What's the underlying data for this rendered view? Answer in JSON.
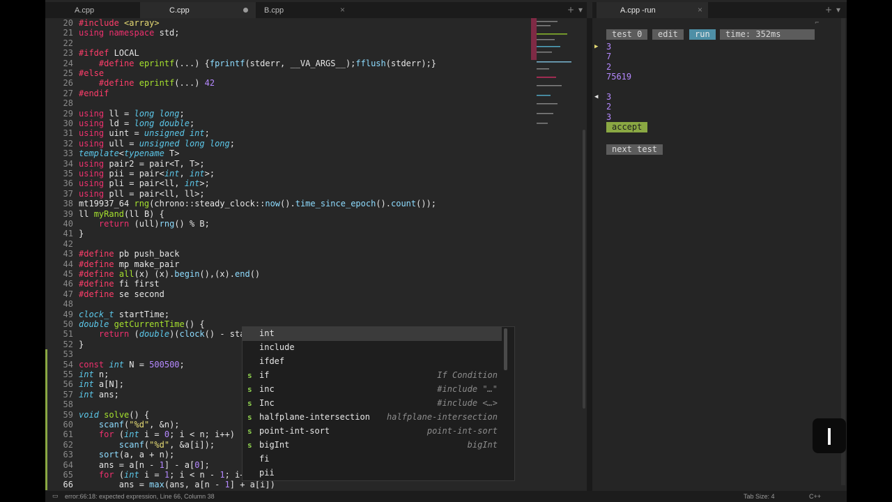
{
  "left_tabs": [
    {
      "label": "A.cpp",
      "close": "×",
      "active": false
    },
    {
      "label": "C.cpp",
      "close": "",
      "active": true,
      "modified": true
    },
    {
      "label": "B.cpp",
      "close": "×",
      "active": false
    }
  ],
  "tab_controls": {
    "add": "+",
    "menu": "▾",
    "back": "◀",
    "forward": "▶"
  },
  "right_tab": {
    "label": "A.cpp -run",
    "close": "×"
  },
  "editor": {
    "current_line": 66,
    "lines": [
      {
        "num": 20,
        "html": "<span class='p'>#include</span> <span class='s'>&lt;array&gt;</span>"
      },
      {
        "num": 21,
        "html": "<span class='k'>using namespace</span> std;"
      },
      {
        "num": 22,
        "html": ""
      },
      {
        "num": 23,
        "html": "<span class='p'>#ifdef</span> LOCAL"
      },
      {
        "num": 24,
        "html": "    <span class='p'>#define</span> <span class='f'>eprintf</span>(...) {<span class='m'>fprintf</span>(stderr, __VA_ARGS__);<span class='m'>fflush</span>(stderr);}"
      },
      {
        "num": 25,
        "html": "<span class='p'>#else</span>"
      },
      {
        "num": 26,
        "html": "    <span class='p'>#define</span> <span class='f'>eprintf</span>(...) <span class='n'>42</span>"
      },
      {
        "num": 27,
        "html": "<span class='p'>#endif</span>"
      },
      {
        "num": 28,
        "html": ""
      },
      {
        "num": 29,
        "html": "<span class='k'>using</span> ll = <span class='t'>long long</span>;"
      },
      {
        "num": 30,
        "html": "<span class='k'>using</span> ld = <span class='t'>long double</span>;"
      },
      {
        "num": 31,
        "html": "<span class='k'>using</span> uint = <span class='t'>unsigned int</span>;"
      },
      {
        "num": 32,
        "html": "<span class='k'>using</span> ull = <span class='t'>unsigned long long</span>;"
      },
      {
        "num": 33,
        "html": "<span class='t'>template</span>&lt;<span class='t'>typename</span> T&gt;"
      },
      {
        "num": 34,
        "html": "<span class='k'>using</span> pair2 = pair&lt;T, T&gt;;"
      },
      {
        "num": 35,
        "html": "<span class='k'>using</span> pii = pair&lt;<span class='t'>int</span>, <span class='t'>int</span>&gt;;"
      },
      {
        "num": 36,
        "html": "<span class='k'>using</span> pli = pair&lt;ll, <span class='t'>int</span>&gt;;"
      },
      {
        "num": 37,
        "html": "<span class='k'>using</span> pll = pair&lt;ll, ll&gt;;"
      },
      {
        "num": 38,
        "html": "mt19937_64 <span class='f'>rng</span>(chrono::steady_clock::<span class='m'>now</span>().<span class='m'>time_since_epoch</span>().<span class='m'>count</span>());"
      },
      {
        "num": 39,
        "html": "ll <span class='f'>myRand</span>(ll B) {"
      },
      {
        "num": 40,
        "html": "    <span class='k'>return</span> (ull)<span class='m'>rng</span>() % B;"
      },
      {
        "num": 41,
        "html": "}"
      },
      {
        "num": 42,
        "html": ""
      },
      {
        "num": 43,
        "html": "<span class='p'>#define</span> pb push_back"
      },
      {
        "num": 44,
        "html": "<span class='p'>#define</span> mp make_pair"
      },
      {
        "num": 45,
        "html": "<span class='p'>#define</span> <span class='f'>all</span>(x) (x).<span class='m'>begin</span>(),(x).<span class='m'>end</span>()"
      },
      {
        "num": 46,
        "html": "<span class='p'>#define</span> fi first"
      },
      {
        "num": 47,
        "html": "<span class='p'>#define</span> se second"
      },
      {
        "num": 48,
        "html": ""
      },
      {
        "num": 49,
        "html": "<span class='t'>clock_t</span> startTime;"
      },
      {
        "num": 50,
        "html": "<span class='t'>double</span> <span class='f'>getCurrentTime</span>() {"
      },
      {
        "num": 51,
        "html": "    <span class='k'>return</span> (<span class='t'>double</span>)(<span class='m'>clock</span>() - sta"
      },
      {
        "num": 52,
        "html": "}"
      },
      {
        "num": 53,
        "html": ""
      },
      {
        "num": 54,
        "html": "<span class='k'>const</span> <span class='t'>int</span> N = <span class='n'>500500</span>;"
      },
      {
        "num": 55,
        "html": "<span class='t'>int</span> n;"
      },
      {
        "num": 56,
        "html": "<span class='t'>int</span> a[N];"
      },
      {
        "num": 57,
        "html": "<span class='t'>int</span> ans;"
      },
      {
        "num": 58,
        "html": ""
      },
      {
        "num": 59,
        "html": "<span class='t'>void</span> <span class='f'>solve</span>() {"
      },
      {
        "num": 60,
        "html": "    <span class='m'>scanf</span>(<span class='s'>\"%d\"</span>, &amp;n);"
      },
      {
        "num": 61,
        "html": "    <span class='k'>for</span> (<span class='t'>int</span> i = <span class='n'>0</span>; i &lt; n; i++)"
      },
      {
        "num": 62,
        "html": "        <span class='m'>scanf</span>(<span class='s'>\"%d\"</span>, &amp;a[i]);"
      },
      {
        "num": 63,
        "html": "    <span class='m'>sort</span>(a, a + n);"
      },
      {
        "num": 64,
        "html": "    ans = a[n - <span class='n'>1</span>] - a[<span class='n'>0</span>];"
      },
      {
        "num": 65,
        "html": "    <span class='k'>for</span> (<span class='t'>int</span> i = <span class='n'>1</span>; i &lt; n - <span class='n'>1</span>; i+"
      },
      {
        "num": 66,
        "html": "        ans = <span class='m'>max</span>(ans, a[n - <span class='n'>1</span>] + a[i])"
      }
    ]
  },
  "autocomplete": {
    "items": [
      {
        "kind": "",
        "label": "int",
        "hint": "",
        "selected": true
      },
      {
        "kind": "",
        "label": "include",
        "hint": ""
      },
      {
        "kind": "",
        "label": "ifdef",
        "hint": ""
      },
      {
        "kind": "s",
        "label": "if",
        "hint": "If Condition"
      },
      {
        "kind": "s",
        "label": "inc",
        "hint": "#include \"…\""
      },
      {
        "kind": "s",
        "label": "Inc",
        "hint": "#include <…>"
      },
      {
        "kind": "s",
        "label": "halfplane-intersection",
        "hint": "halfplane-intersection"
      },
      {
        "kind": "s",
        "label": "point-int-sort",
        "hint": "point-int-sort"
      },
      {
        "kind": "s",
        "label": "bigInt",
        "hint": "bigInt"
      },
      {
        "kind": "",
        "label": "fi",
        "hint": ""
      },
      {
        "kind": "",
        "label": "pii",
        "hint": ""
      }
    ]
  },
  "run_panel": {
    "test_label": "test 0",
    "edit_label": "edit",
    "run_label": "run",
    "time_label": "time: 352ms",
    "input_lines": [
      "3",
      "7",
      "2",
      "75619"
    ],
    "output_lines": [
      "3",
      "2",
      "3"
    ],
    "accept_label": "accept",
    "next_test_label": "next test",
    "colors": {
      "input_arrow": "#e6db74",
      "output_arrow": "#e6e6e6",
      "values": "#b589ff",
      "accept": "#8aa843",
      "run": "#4e8fa6"
    }
  },
  "status_bar": {
    "message": "error:66:18: expected expression, Line 66, Column 38",
    "tab_size": "Tab Size: 4",
    "syntax": "C++"
  }
}
